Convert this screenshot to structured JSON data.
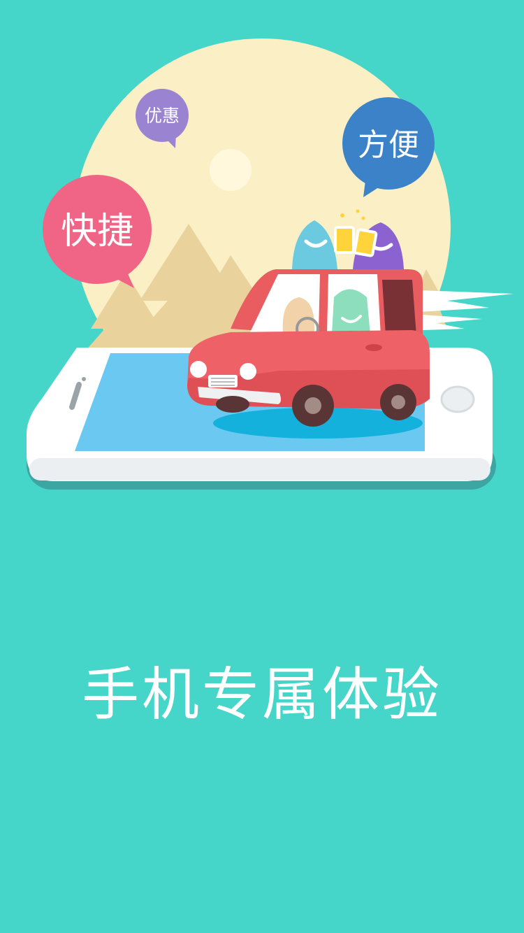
{
  "screen": {
    "headline": "手机专属体验",
    "background_color": "#45d6c9"
  },
  "bubbles": {
    "quick": {
      "label": "快捷",
      "color": "#f06585"
    },
    "discount": {
      "label": "优惠",
      "color": "#9a84d2"
    },
    "convenient": {
      "label": "方便",
      "color": "#3b82c9"
    }
  }
}
